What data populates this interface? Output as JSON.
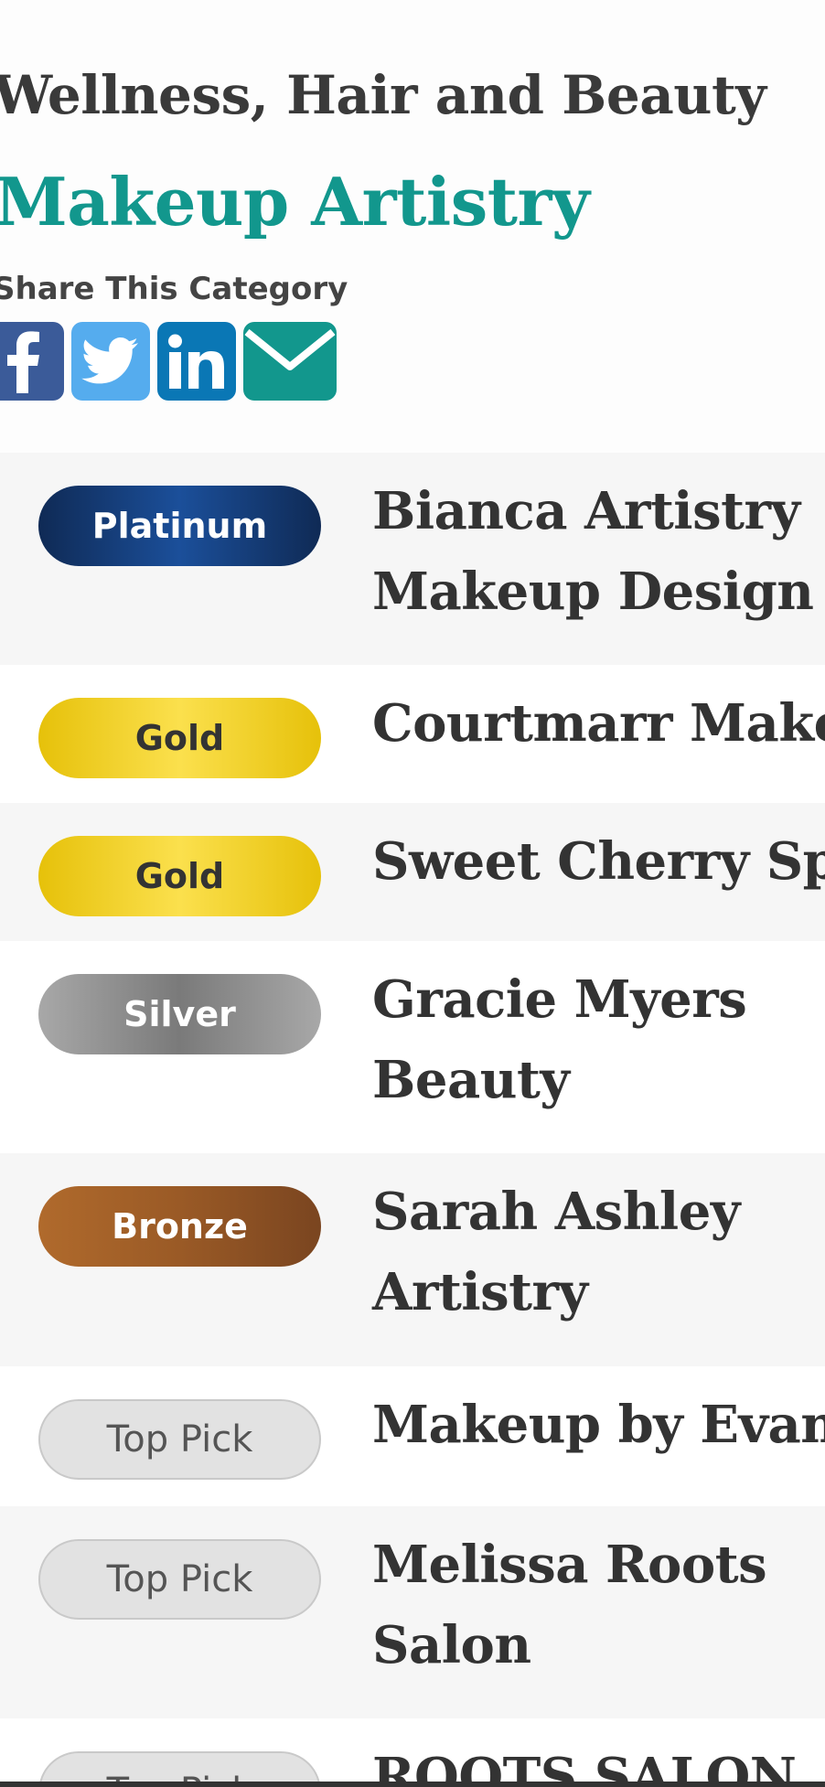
{
  "category": {
    "parent": "Wellness, Hair and Beauty",
    "title": "Makeup Artistry",
    "share_label": "Share This Category"
  },
  "share": {
    "buttons": [
      {
        "icon": "facebook-icon",
        "color": "#3b5b99"
      },
      {
        "icon": "twitter-icon",
        "color": "#55acee"
      },
      {
        "icon": "linkedin-icon",
        "color": "#0a77b5"
      },
      {
        "icon": "email-icon",
        "color": "#12978d"
      }
    ]
  },
  "listings": [
    {
      "tier": "Platinum",
      "name_line1": "Bianca Artistry",
      "name_line2": "Makeup Design"
    },
    {
      "tier": "Gold",
      "name_line1": "Courtmarr Makeup",
      "name_line2": ""
    },
    {
      "tier": "Gold",
      "name_line1": "Sweet Cherry Spa",
      "name_line2": ""
    },
    {
      "tier": "Silver",
      "name_line1": "Gracie Myers",
      "name_line2": "Beauty"
    },
    {
      "tier": "Bronze",
      "name_line1": "Sarah Ashley",
      "name_line2": "Artistry"
    },
    {
      "tier": "Top Pick",
      "name_line1": "Makeup by Evangeline",
      "name_line2": ""
    },
    {
      "tier": "Top Pick",
      "name_line1": "Melissa Roots",
      "name_line2": "Salon"
    },
    {
      "tier": "Top Pick",
      "name_line1": "ROOTS SALON",
      "name_line2": ""
    }
  ],
  "colors": {
    "accent": "#12978d",
    "text": "#333333",
    "platinum": "#1b4f9a",
    "gold": "#f4d21f",
    "silver": "#8e8e8e",
    "bronze": "#9a5a26",
    "top_pick": "#e2e2e2"
  }
}
